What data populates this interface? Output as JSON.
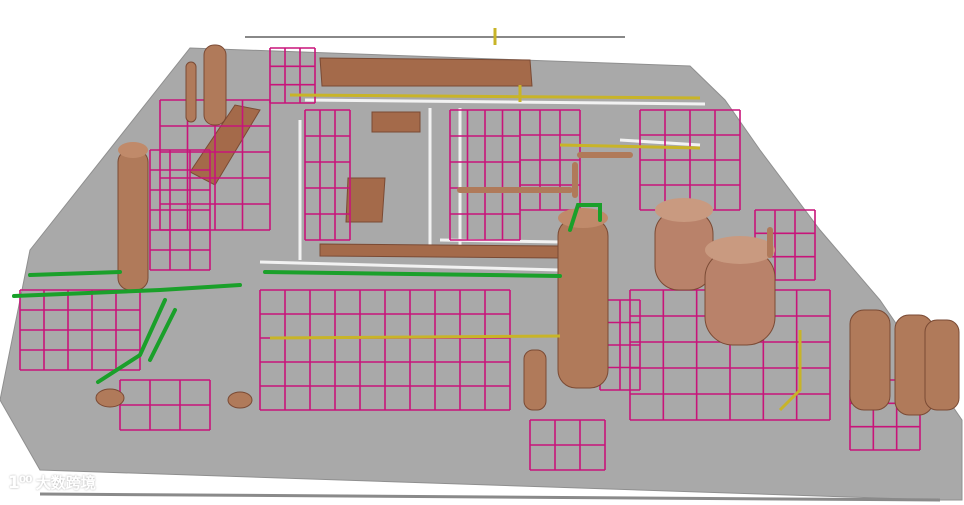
{
  "watermark": {
    "logo": "1⁰⁰",
    "text": "大数跨境"
  },
  "colors": {
    "background": "#ffffff",
    "slab": "#a8a8a8",
    "slab_edge": "#8a8a8a",
    "steel": "#c8147a",
    "vessel": "#b07a5a",
    "vessel_dark": "#8a5a40",
    "pipe_green": "#1aa02a",
    "pipe_yellow": "#c8b428",
    "roof": "#a06848",
    "grid_white": "#f0f0f0"
  }
}
